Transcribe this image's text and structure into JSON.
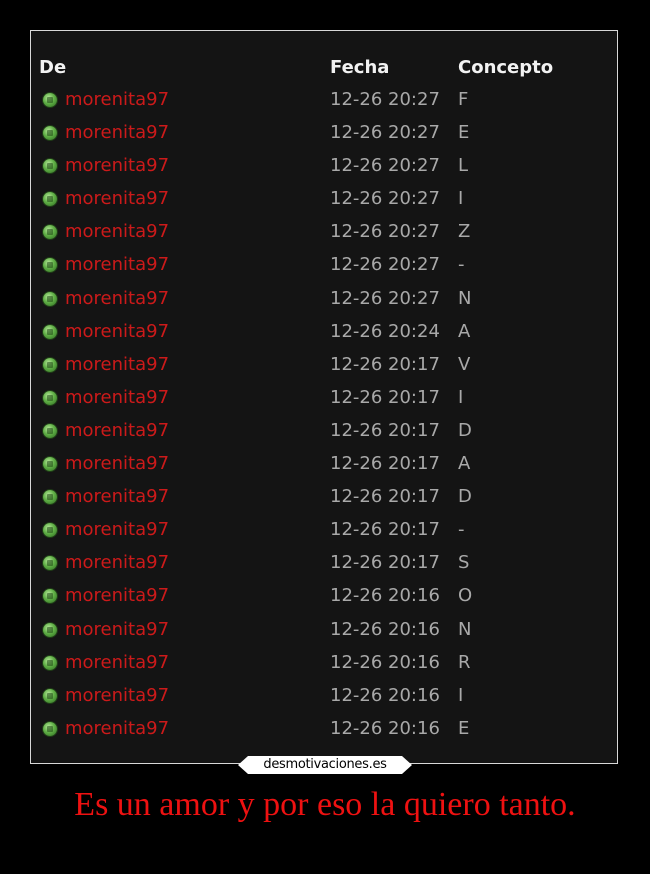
{
  "table": {
    "headers": {
      "de": "De",
      "fecha": "Fecha",
      "concepto": "Concepto"
    },
    "rows": [
      {
        "sender": "morenita97",
        "date": "12-26 20:27",
        "concept": "F"
      },
      {
        "sender": "morenita97",
        "date": "12-26 20:27",
        "concept": "E"
      },
      {
        "sender": "morenita97",
        "date": "12-26 20:27",
        "concept": "L"
      },
      {
        "sender": "morenita97",
        "date": "12-26 20:27",
        "concept": "I"
      },
      {
        "sender": "morenita97",
        "date": "12-26 20:27",
        "concept": "Z"
      },
      {
        "sender": "morenita97",
        "date": "12-26 20:27",
        "concept": "-"
      },
      {
        "sender": "morenita97",
        "date": "12-26 20:27",
        "concept": "N"
      },
      {
        "sender": "morenita97",
        "date": "12-26 20:24",
        "concept": "A"
      },
      {
        "sender": "morenita97",
        "date": "12-26 20:17",
        "concept": "V"
      },
      {
        "sender": "morenita97",
        "date": "12-26 20:17",
        "concept": "I"
      },
      {
        "sender": "morenita97",
        "date": "12-26 20:17",
        "concept": "D"
      },
      {
        "sender": "morenita97",
        "date": "12-26 20:17",
        "concept": "A"
      },
      {
        "sender": "morenita97",
        "date": "12-26 20:17",
        "concept": "D"
      },
      {
        "sender": "morenita97",
        "date": "12-26 20:17",
        "concept": "-"
      },
      {
        "sender": "morenita97",
        "date": "12-26 20:17",
        "concept": "S"
      },
      {
        "sender": "morenita97",
        "date": "12-26 20:16",
        "concept": "O"
      },
      {
        "sender": "morenita97",
        "date": "12-26 20:16",
        "concept": "N"
      },
      {
        "sender": "morenita97",
        "date": "12-26 20:16",
        "concept": "R"
      },
      {
        "sender": "morenita97",
        "date": "12-26 20:16",
        "concept": "I"
      },
      {
        "sender": "morenita97",
        "date": "12-26 20:16",
        "concept": "E"
      }
    ],
    "status_icon": "online-status-icon"
  },
  "watermark": "desmotivaciones.es",
  "caption": "Es un amor y por eso la quiero tanto.",
  "colors": {
    "background": "#000000",
    "panel": "#141414",
    "frame_border": "#d8d8d8",
    "header_text": "#f2f2f2",
    "sender_text": "#cc1a1a",
    "cell_text": "#a9a9a9",
    "caption_text": "#ee1111",
    "status_green": "#5fae45"
  }
}
